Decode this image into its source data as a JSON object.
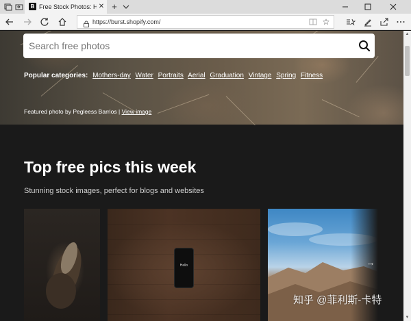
{
  "browser": {
    "tab": {
      "favicon_letter": "B",
      "title": "Free Stock Photos: High"
    },
    "new_tab_symbol": "+",
    "address": {
      "url": "https://burst.shopify.com/"
    }
  },
  "page": {
    "search": {
      "placeholder": "Search free photos"
    },
    "categories": {
      "label": "Popular categories:",
      "items": [
        "Mothers-day",
        "Water",
        "Portraits",
        "Aerial",
        "Graduation",
        "Vintage",
        "Spring",
        "Fitness"
      ]
    },
    "credit": {
      "text": "Featured photo by Pegleess Barrios |",
      "link": "View image"
    },
    "section": {
      "title": "Top free pics this week",
      "subtitle": "Stunning stock images, perfect for blogs and websites"
    },
    "phone_screen_text": "Hello"
  },
  "watermark": "知乎 @菲利斯-卡特",
  "colors": {
    "page_bg": "#1a1a1a",
    "chrome_bg": "#f3f3f3",
    "tabbar_bg": "#dcdcdc"
  }
}
